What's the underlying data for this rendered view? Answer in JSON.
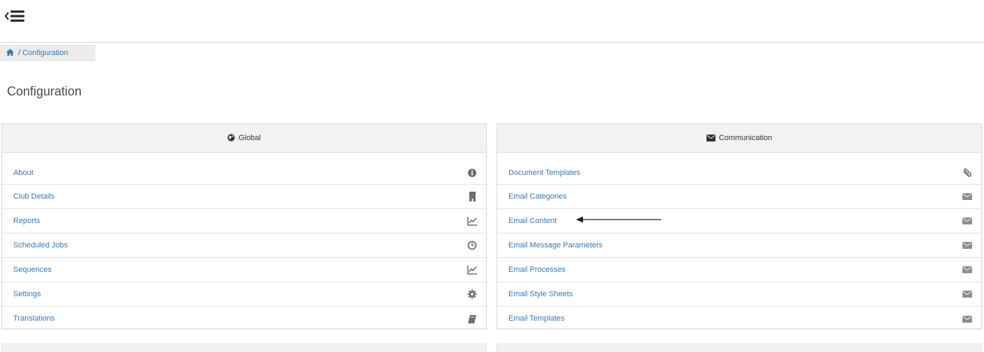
{
  "breadcrumb": {
    "separator": "/",
    "current": "Configuration"
  },
  "page": {
    "title": "Configuration"
  },
  "colors": {
    "link": "#337ab7",
    "header_bg": "#f2f2f2",
    "icon": "#6f6f6f",
    "email_icon": "#8a8f94"
  },
  "global_panel": {
    "title": "Global",
    "icon": "globe-icon",
    "items": [
      {
        "label": "About",
        "icon": "info-icon"
      },
      {
        "label": "Club Details",
        "icon": "building-icon"
      },
      {
        "label": "Reports",
        "icon": "line-chart-icon"
      },
      {
        "label": "Scheduled Jobs",
        "icon": "clock-icon"
      },
      {
        "label": "Sequences",
        "icon": "line-chart-icon"
      },
      {
        "label": "Settings",
        "icon": "gear-icon"
      },
      {
        "label": "Translations",
        "icon": "book-icon"
      }
    ]
  },
  "communication_panel": {
    "title": "Communication",
    "icon": "envelope-icon",
    "items": [
      {
        "label": "Document Templates",
        "icon": "paperclip-icon"
      },
      {
        "label": "Email Categories",
        "icon": "envelope-icon"
      },
      {
        "label": "Email Content",
        "icon": "envelope-icon"
      },
      {
        "label": "Email Message Parameters",
        "icon": "envelope-icon"
      },
      {
        "label": "Email Processes",
        "icon": "envelope-icon"
      },
      {
        "label": "Email Style Sheets",
        "icon": "envelope-icon"
      },
      {
        "label": "Email Templates",
        "icon": "envelope-icon"
      }
    ]
  }
}
